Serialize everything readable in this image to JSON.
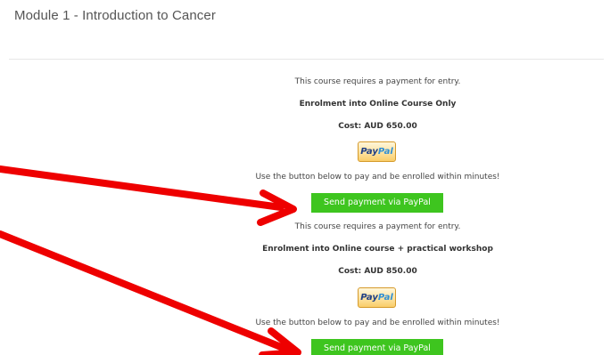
{
  "page": {
    "title": "Module 1 - Introduction to Cancer"
  },
  "enrolments": [
    {
      "notice": "This course requires a payment for entry.",
      "option": "Enrolment into Online Course Only",
      "cost": "Cost: AUD 650.00",
      "paypal_pay": "Pay",
      "paypal_pal": "Pal",
      "instruction": "Use the button below to pay and be enrolled within minutes!",
      "button_label": "Send payment via PayPal"
    },
    {
      "notice": "This course requires a payment for entry.",
      "option": "Enrolment into Online course + practical workshop",
      "cost": "Cost: AUD 850.00",
      "paypal_pay": "Pay",
      "paypal_pal": "Pal",
      "instruction": "Use the button below to pay and be enrolled within minutes!",
      "button_label": "Send payment via PayPal"
    }
  ],
  "colors": {
    "button_green": "#3ec51f",
    "arrow_red": "#ee0000",
    "paypal_dark": "#1e3f85",
    "paypal_light": "#2f8fd4"
  },
  "icons": {
    "paypal": "paypal-logo",
    "annotation": "red-arrow"
  }
}
